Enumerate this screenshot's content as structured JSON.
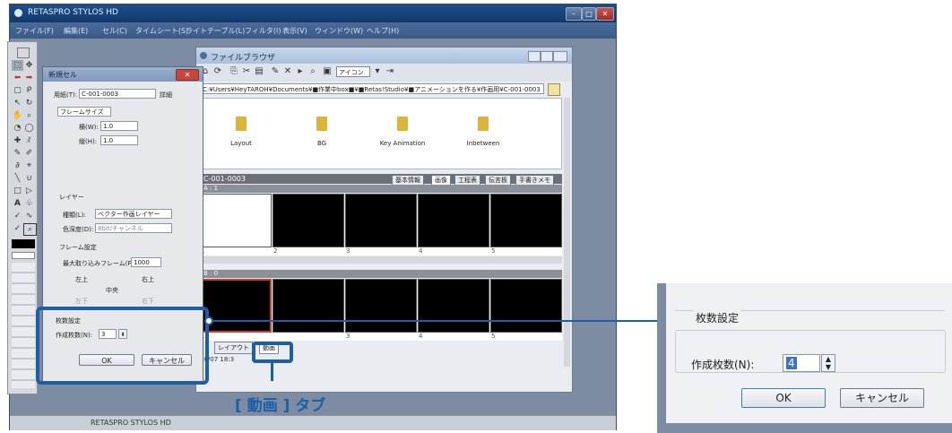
{
  "app": {
    "title": "RETASPRO STYLOS HD",
    "menu": [
      "ファイル(F)",
      "編集(E)",
      "セル(C)",
      "タイムシート(S)",
      "ライトテーブル(L)",
      "フィルタ(I)",
      "表示(V)",
      "ウィンドウ(W)",
      "ヘルプ(H)"
    ],
    "status": "RETASPRO STYLOS HD"
  },
  "file_browser": {
    "title": "ファイルブラウザ",
    "view_dropdown": "アイコン",
    "path": "C:¥Users¥HeyTAROH¥Documents¥■作業中box■¥■Retas!Studio¥■アニメーションを作る¥作画用¥C-001-0003",
    "folders": [
      "Layout",
      "BG",
      "Key Animation",
      "Inbetween"
    ],
    "cell_name": "C-001-0003",
    "tabs": [
      "基本情報",
      "画像",
      "工程表",
      "伝言板",
      "手書きメモ"
    ],
    "track_a": "A : 1",
    "track_b": "B : 0",
    "ruler": [
      "1",
      "2",
      "3",
      "4",
      "5"
    ],
    "bottom_tabs": [
      "レイアウト",
      "動画"
    ],
    "date": "10/07 18:3"
  },
  "new_cell_dialog": {
    "title": "新規セル",
    "paper_label": "用紙(T):",
    "paper_value": "C-001-0003",
    "detail_label": "詳細",
    "frame_size_label": "フレームサイズ",
    "width_label": "横(W):",
    "width_value": "1.0",
    "height_label": "縦(H):",
    "height_value": "1.0",
    "layer_section": "レイヤー",
    "kind_label": "種類(L):",
    "kind_value": "ベクター作画レイヤー",
    "depth_label": "色深度(D):",
    "depth_value": "8bit/チャンネル",
    "frame_setting": "フレーム設定",
    "max_frames_label": "最大取り込みフレーム(F):",
    "max_frames_value": "1000",
    "positions": [
      "左上",
      "右上",
      "中央",
      "左下",
      "右下"
    ],
    "count_section": "枚数設定",
    "count_label": "作成枚数(N):",
    "count_value": "3",
    "ok": "OK",
    "cancel": "キャンセル"
  },
  "zoom_panel": {
    "count_section": "枚数設定",
    "count_label": "作成枚数(N):",
    "count_value": "4",
    "ok": "OK",
    "cancel": "キャンセル"
  },
  "callout": {
    "label": "[ 動画 ] タブ"
  }
}
